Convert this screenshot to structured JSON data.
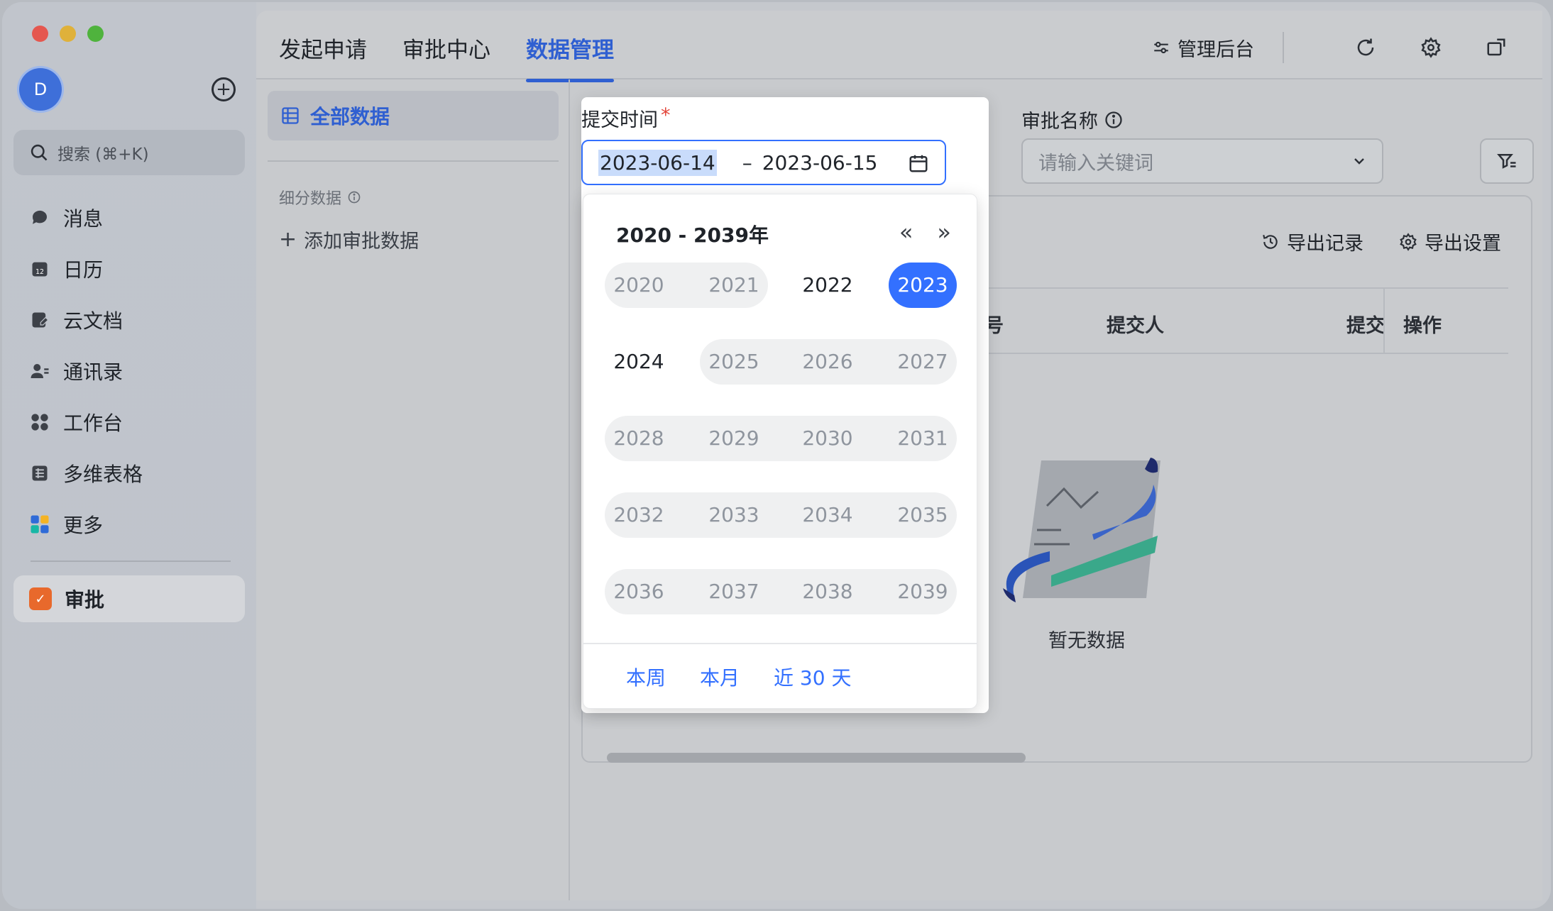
{
  "sidebar": {
    "avatar_letter": "D",
    "search_placeholder": "搜索 (⌘+K)",
    "items": [
      {
        "label": "消息",
        "icon": "chat-bubble-icon"
      },
      {
        "label": "日历",
        "icon": "calendar-icon"
      },
      {
        "label": "云文档",
        "icon": "doc-icon"
      },
      {
        "label": "通讯录",
        "icon": "contacts-icon"
      },
      {
        "label": "工作台",
        "icon": "workspace-icon"
      },
      {
        "label": "多维表格",
        "icon": "table-icon"
      },
      {
        "label": "更多",
        "icon": "more-apps-icon"
      }
    ],
    "active_app": {
      "label": "审批",
      "icon": "approval-icon"
    }
  },
  "topbar": {
    "tabs": [
      {
        "label": "发起申请",
        "active": false
      },
      {
        "label": "审批中心",
        "active": false
      },
      {
        "label": "数据管理",
        "active": true
      }
    ],
    "admin_label": "管理后台"
  },
  "subnav": {
    "all_data": "全部数据",
    "section_label": "细分数据",
    "add_label": "添加审批数据"
  },
  "filters": {
    "submit_time_label": "提交时间",
    "required_mark": "*",
    "date_start": "2023-06-14",
    "date_sep": "–",
    "date_end": "2023-06-15",
    "approval_name_label": "审批名称",
    "approval_name_placeholder": "请输入关键词"
  },
  "date_picker": {
    "range_title": "2020 - 2039年",
    "years": [
      "2020",
      "2021",
      "2022",
      "2023",
      "2024",
      "2025",
      "2026",
      "2027",
      "2028",
      "2029",
      "2030",
      "2031",
      "2032",
      "2033",
      "2034",
      "2035",
      "2036",
      "2037",
      "2038",
      "2039"
    ],
    "selected_year": "2023",
    "shortcuts": [
      "本周",
      "本月",
      "近 30 天"
    ]
  },
  "table": {
    "export_records": "导出记录",
    "export_settings": "导出设置",
    "headers": {
      "partial": "号",
      "submitter": "提交人",
      "submit_partial": "提交",
      "actions": "操作"
    },
    "empty_text": "暂无数据"
  },
  "colors": {
    "accent": "#3370ff",
    "tab_active": "#2f5fd1",
    "required": "#e3453a"
  }
}
